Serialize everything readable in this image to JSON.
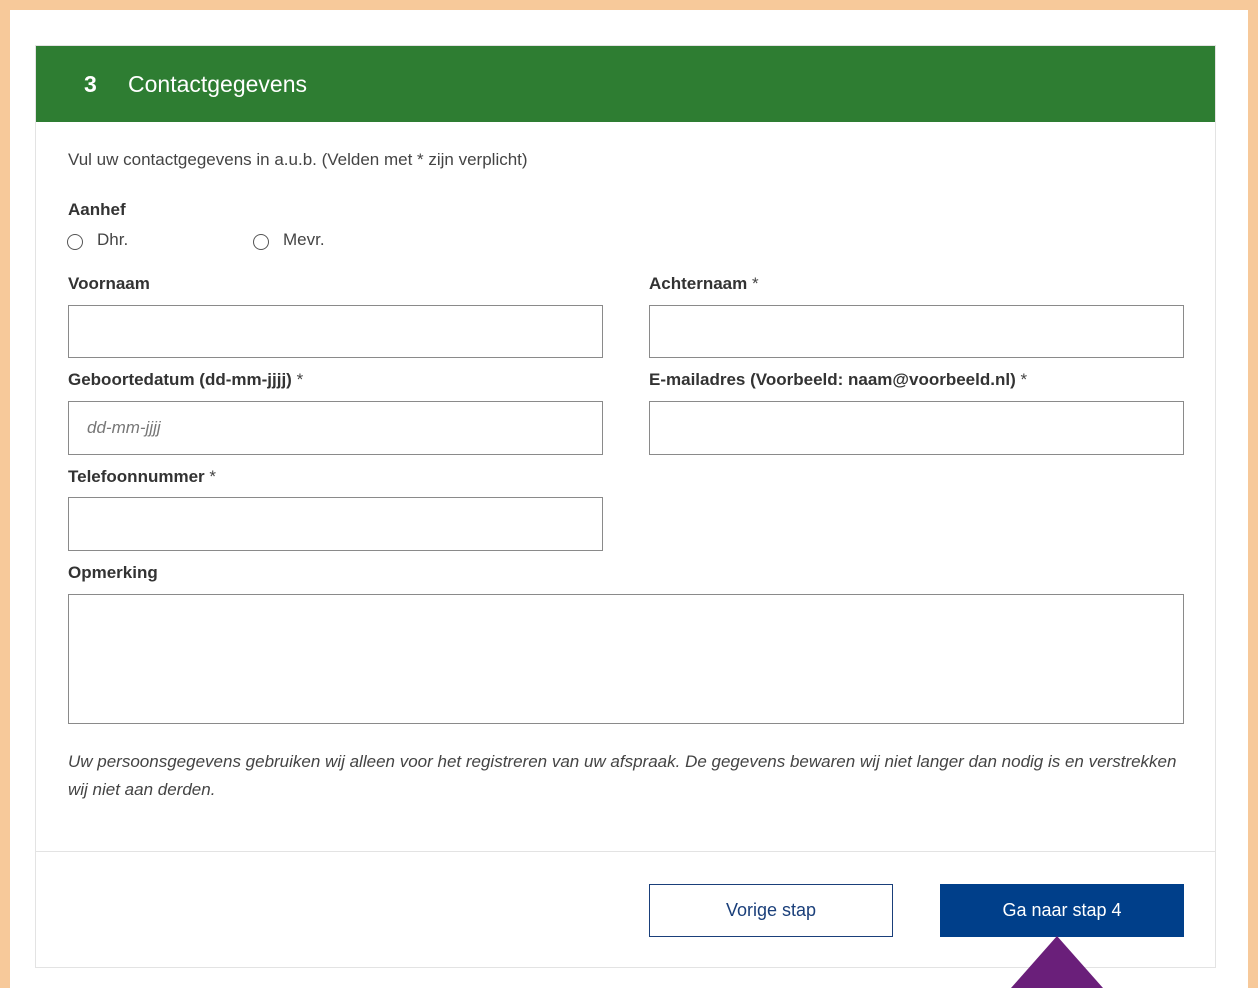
{
  "header": {
    "step_number": "3",
    "title": "Contactgegevens"
  },
  "intro": "Vul uw contactgegevens in a.u.b. (Velden met * zijn verplicht)",
  "salutation": {
    "label": "Aanhef",
    "options": [
      "Dhr.",
      "Mevr."
    ],
    "selected": null
  },
  "fields": {
    "first_name": {
      "label": "Voornaam",
      "value": "",
      "required": false
    },
    "last_name": {
      "label": "Achternaam",
      "required_mark": "*",
      "value": ""
    },
    "birthdate": {
      "label": "Geboortedatum (dd-mm-jjjj)",
      "required_mark": "*",
      "placeholder": "dd-mm-jjjj",
      "value": ""
    },
    "email": {
      "label": "E-mailadres (Voorbeeld: naam@voorbeeld.nl)",
      "required_mark": "*",
      "value": ""
    },
    "phone": {
      "label": "Telefoonnummer",
      "required_mark": "*",
      "value": ""
    },
    "remark": {
      "label": "Opmerking",
      "value": ""
    }
  },
  "privacy_note": "Uw persoonsgegevens gebruiken wij alleen voor het registreren van uw afspraak. De gegevens bewaren wij niet langer dan nodig is en verstrekken wij niet aan derden.",
  "buttons": {
    "previous": "Vorige stap",
    "next": "Ga naar stap 4"
  },
  "colors": {
    "header_bg": "#2e7d32",
    "primary_button": "#003f8a",
    "page_border": "#f7c99a",
    "highlight_arrow": "#6a1f7a"
  }
}
